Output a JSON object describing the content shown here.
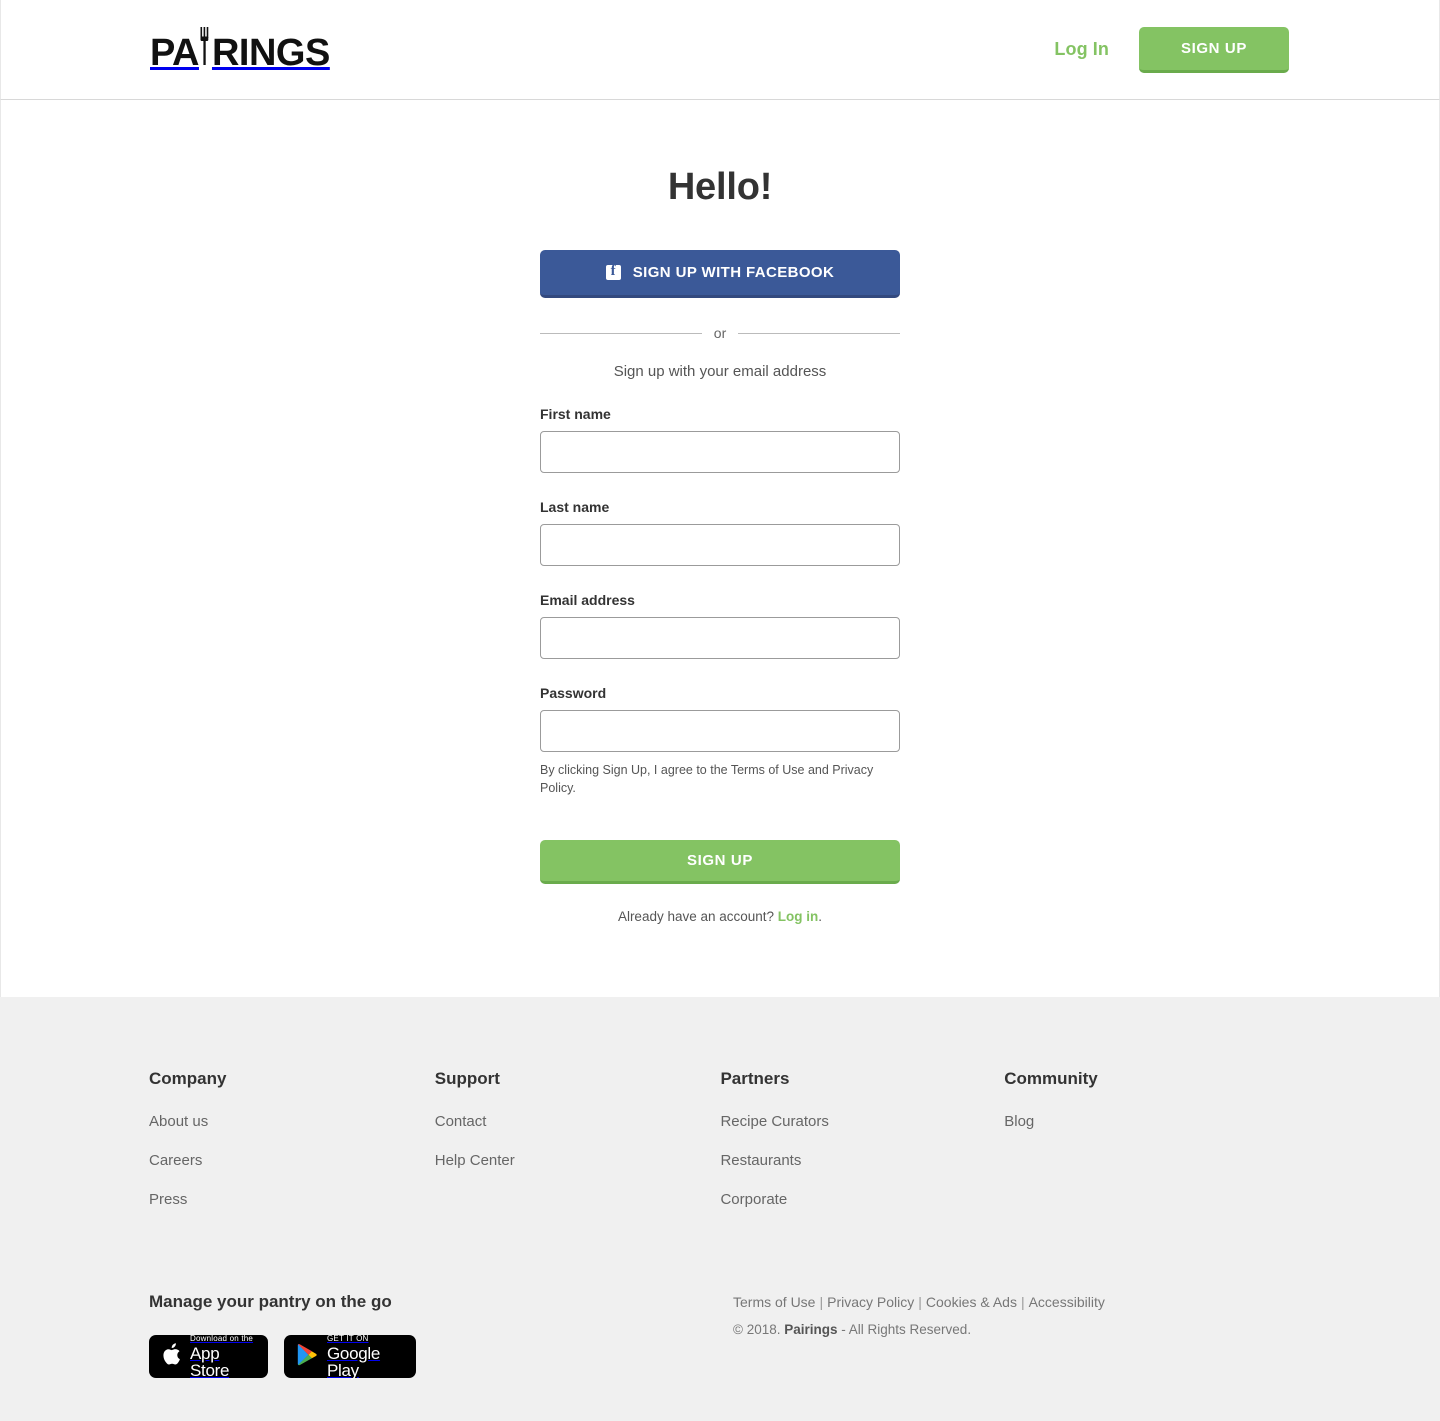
{
  "brand": {
    "name": "PAIRINGS",
    "name_part_1": "PA",
    "name_part_2": "RINGS",
    "accent_color": "#84c363",
    "facebook_color": "#3b5998"
  },
  "header": {
    "login_label": "Log In",
    "signup_label": "SIGN UP"
  },
  "main": {
    "heading": "Hello!",
    "facebook_button": {
      "icon": "facebook-icon",
      "label": "SIGN UP WITH FACEBOOK"
    },
    "divider_label": "or",
    "email_prompt": "Sign up with your email address",
    "fields": [
      {
        "key": "first_name",
        "label": "First name",
        "value": "",
        "placeholder": "",
        "type": "text"
      },
      {
        "key": "last_name",
        "label": "Last name",
        "value": "",
        "placeholder": "",
        "type": "text"
      },
      {
        "key": "email",
        "label": "Email address",
        "value": "",
        "placeholder": "",
        "type": "email"
      },
      {
        "key": "password",
        "label": "Password",
        "value": "",
        "placeholder": "",
        "type": "password"
      }
    ],
    "terms_text": "By clicking Sign Up, I agree to the Terms of Use and Privacy Policy.",
    "submit_label": "SIGN UP",
    "have_account_text": "Already have an account? ",
    "have_account_link": "Log in",
    "have_account_period": "."
  },
  "footer": {
    "columns": [
      {
        "title": "Company",
        "links": [
          "About us",
          "Careers",
          "Press"
        ]
      },
      {
        "title": "Support",
        "links": [
          "Contact",
          "Help Center"
        ]
      },
      {
        "title": "Partners",
        "links": [
          "Recipe Curators",
          "Restaurants",
          "Corporate"
        ]
      },
      {
        "title": "Community",
        "links": [
          "Blog"
        ]
      }
    ],
    "apps_title": "Manage your pantry on the go",
    "app_store": {
      "small": "Download on the",
      "big": "App Store",
      "icon": "apple-icon"
    },
    "google_play": {
      "small": "GET IT ON",
      "big": "Google Play",
      "icon": "google-play-icon"
    },
    "legal_links": [
      "Terms of Use",
      "Privacy Policy",
      "Cookies & Ads",
      "Accessibility"
    ],
    "legal_separator": "|",
    "copyright_prefix": "© 2018. ",
    "copyright_brand": "Pairings",
    "copyright_suffix": " - All Rights Reserved."
  }
}
